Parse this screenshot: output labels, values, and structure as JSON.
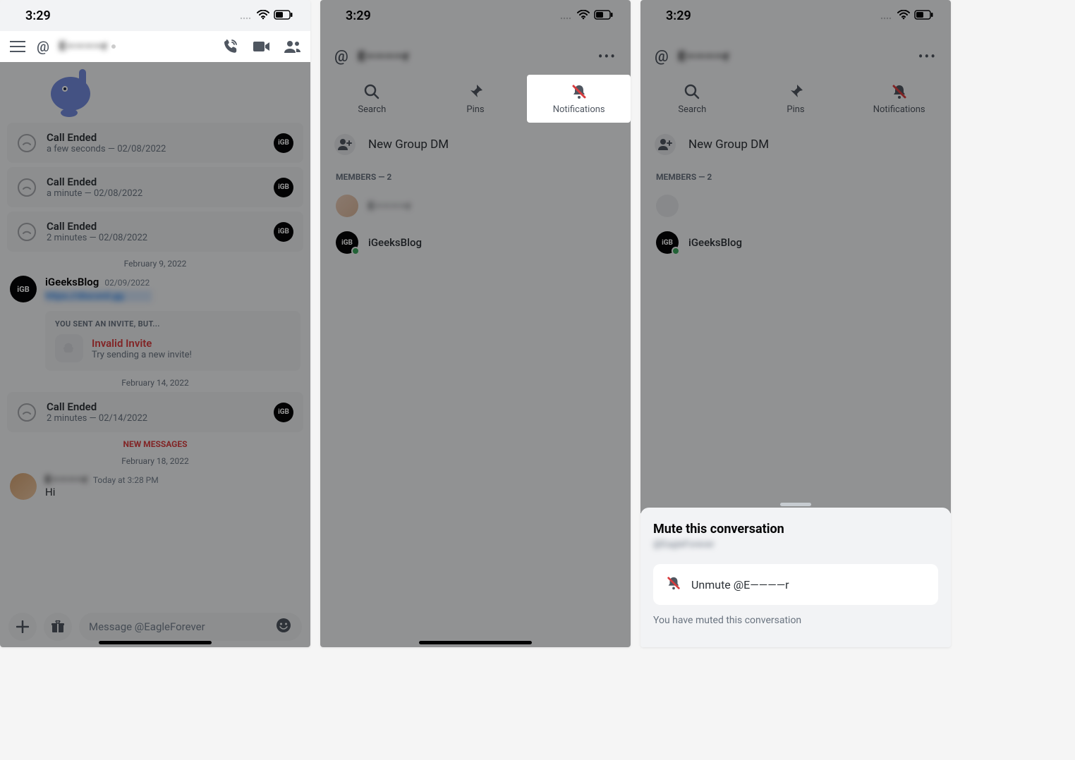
{
  "status": {
    "time": "3:29"
  },
  "panel1": {
    "channel_name": "E————r",
    "calls": [
      {
        "title": "Call Ended",
        "sub": "a few seconds — 02/08/2022",
        "badge": "iGB"
      },
      {
        "title": "Call Ended",
        "sub": "a minute — 02/08/2022",
        "badge": "iGB"
      },
      {
        "title": "Call Ended",
        "sub": "2 minutes — 02/08/2022",
        "badge": "iGB"
      }
    ],
    "divider1": "February 9, 2022",
    "msg1": {
      "user": "iGeeksBlog",
      "time": "02/09/2022",
      "link": "https://discord.gg"
    },
    "invite": {
      "head": "YOU SENT AN INVITE, BUT...",
      "title": "Invalid Invite",
      "sub": "Try sending a new invite!"
    },
    "divider2": "February 14, 2022",
    "call4": {
      "title": "Call Ended",
      "sub": "2 minutes — 02/14/2022",
      "badge": "iGB"
    },
    "new_messages": "NEW MESSAGES",
    "divider3": "February 18, 2022",
    "msg2": {
      "user": "E————r",
      "time": "Today at 3:28 PM",
      "text": "Hi"
    },
    "composer_placeholder": "Message @EagleForever"
  },
  "panel2": {
    "channel_name": "E————r",
    "tabs": {
      "search": "Search",
      "pins": "Pins",
      "notifications": "Notifications"
    },
    "group_dm": "New Group DM",
    "members_head": "MEMBERS — 2",
    "members": [
      {
        "name": "E————r"
      },
      {
        "name": "iGeeksBlog"
      }
    ]
  },
  "panel3": {
    "channel_name": "E————r",
    "tabs": {
      "search": "Search",
      "pins": "Pins",
      "notifications": "Notifications"
    },
    "group_dm": "New Group DM",
    "members_head": "MEMBERS — 2",
    "members": [
      {
        "name": ""
      },
      {
        "name": "iGeeksBlog"
      }
    ],
    "sheet": {
      "title": "Mute this conversation",
      "sub": "@EagleForever",
      "button": "Unmute @E————r",
      "note": "You have muted this conversation"
    }
  }
}
